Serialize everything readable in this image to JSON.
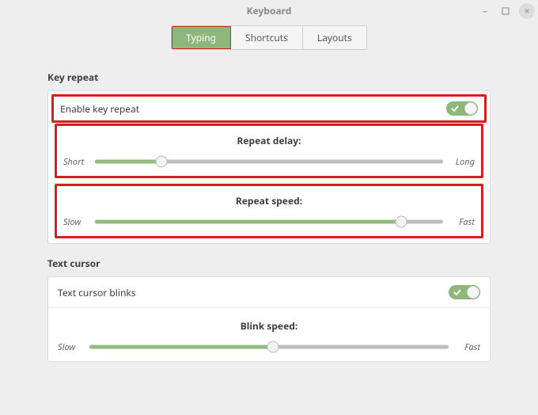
{
  "window": {
    "title": "Keyboard"
  },
  "tabs": [
    {
      "label": "Typing"
    },
    {
      "label": "Shortcuts"
    },
    {
      "label": "Layouts"
    }
  ],
  "key_repeat": {
    "section_title": "Key repeat",
    "enable_label": "Enable key repeat",
    "enabled": true,
    "delay": {
      "title": "Repeat delay:",
      "min_label": "Short",
      "max_label": "Long",
      "value_pct": 19
    },
    "speed": {
      "title": "Repeat speed:",
      "min_label": "Slow",
      "max_label": "Fast",
      "value_pct": 88
    }
  },
  "text_cursor": {
    "section_title": "Text cursor",
    "blinks_label": "Text cursor blinks",
    "blinks": true,
    "blink_speed": {
      "title": "Blink speed:",
      "min_label": "Slow",
      "max_label": "Fast",
      "value_pct": 51
    }
  }
}
